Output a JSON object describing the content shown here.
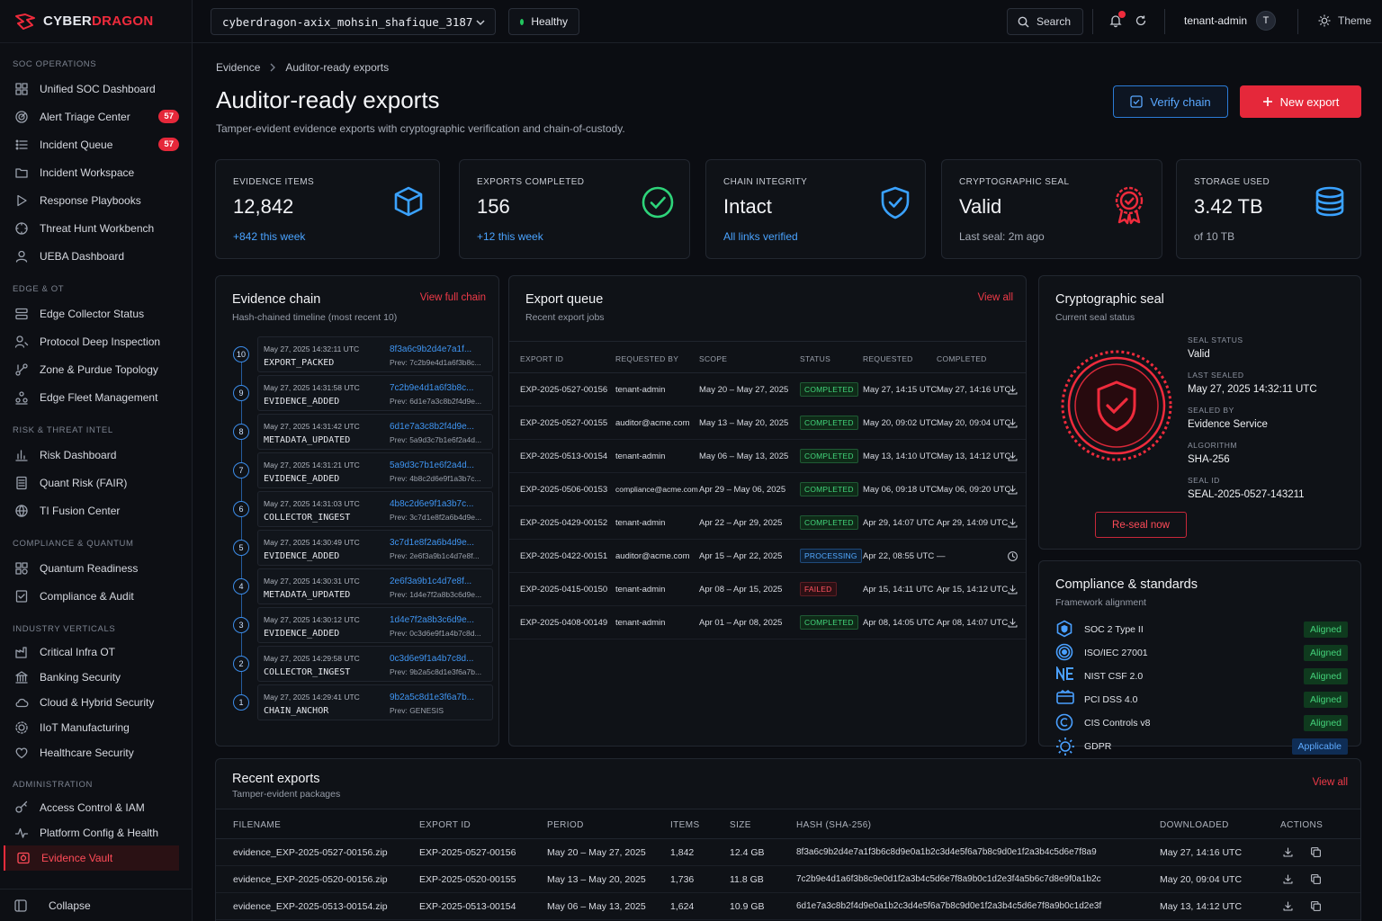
{
  "brand": {
    "name_a": "CYBER",
    "name_b": "DRAGON"
  },
  "topbar": {
    "tenant": "cyberdragon-axix_mohsin_shafique_3187",
    "health": "Healthy",
    "search": "Search",
    "user": "tenant-admin",
    "avatar": "T",
    "theme": "Theme"
  },
  "sidebar": {
    "sections": [
      {
        "title": "SOC OPERATIONS",
        "items": [
          {
            "label": "Unified SOC Dashboard",
            "icon": "grid-icon"
          },
          {
            "label": "Alert Triage Center",
            "icon": "radar-icon",
            "badge": "57"
          },
          {
            "label": "Incident Queue",
            "icon": "list-icon",
            "badge": "57"
          },
          {
            "label": "Incident Workspace",
            "icon": "folder-icon"
          },
          {
            "label": "Response Playbooks",
            "icon": "play-icon"
          },
          {
            "label": "Threat Hunt Workbench",
            "icon": "target-icon"
          },
          {
            "label": "UEBA Dashboard",
            "icon": "user-icon"
          }
        ]
      },
      {
        "title": "EDGE & OT",
        "items": [
          {
            "label": "Edge Collector Status",
            "icon": "server-icon"
          },
          {
            "label": "Protocol Deep Inspection",
            "icon": "inspect-icon"
          },
          {
            "label": "Zone & Purdue Topology",
            "icon": "topology-icon"
          },
          {
            "label": "Edge Fleet Management",
            "icon": "fleet-icon"
          }
        ]
      },
      {
        "title": "RISK & THREAT INTEL",
        "items": [
          {
            "label": "Risk Dashboard",
            "icon": "bar-chart-icon"
          },
          {
            "label": "Quant Risk (FAIR)",
            "icon": "calculator-icon"
          },
          {
            "label": "TI Fusion Center",
            "icon": "globe-icon"
          }
        ]
      },
      {
        "title": "COMPLIANCE & QUANTUM",
        "items": [
          {
            "label": "Quantum Readiness",
            "icon": "atom-icon"
          },
          {
            "label": "Compliance & Audit",
            "icon": "checklist-icon"
          }
        ]
      },
      {
        "title": "INDUSTRY VERTICALS",
        "items": [
          {
            "label": "Critical Infra OT",
            "icon": "factory-icon"
          },
          {
            "label": "Banking Security",
            "icon": "bank-icon"
          },
          {
            "label": "Cloud & Hybrid Security",
            "icon": "cloud-icon"
          },
          {
            "label": "IIoT Manufacturing",
            "icon": "chip-icon"
          },
          {
            "label": "Healthcare Security",
            "icon": "heart-icon"
          }
        ]
      },
      {
        "title": "ADMINISTRATION",
        "items": [
          {
            "label": "Access Control & IAM",
            "icon": "key-icon"
          },
          {
            "label": "Platform Config & Health",
            "icon": "pulse-icon"
          },
          {
            "label": "Evidence Vault",
            "icon": "vault-icon",
            "active": true
          }
        ]
      }
    ],
    "collapse": "Collapse"
  },
  "breadcrumb": {
    "parent": "Evidence",
    "current": "Auditor-ready exports"
  },
  "page": {
    "title": "Auditor-ready exports",
    "subtitle": "Tamper-evident evidence exports with cryptographic verification and chain-of-custody.",
    "verify_label": "Verify chain",
    "new_label": "New export"
  },
  "stats": [
    {
      "label": "EVIDENCE ITEMS",
      "value": "12,842",
      "note": "+842 this week",
      "note_color": "#4aa3ff",
      "icon": "cube-icon"
    },
    {
      "label": "EXPORTS COMPLETED",
      "value": "156",
      "note": "+12 this week",
      "note_color": "#4aa3ff",
      "icon": "check-circle-icon"
    },
    {
      "label": "CHAIN INTEGRITY",
      "value": "Intact",
      "note": "All links verified",
      "note_color": "#4aa3ff",
      "icon": "shield-check-icon"
    },
    {
      "label": "CRYPTOGRAPHIC SEAL",
      "value": "Valid",
      "note": "Last seal: 2m ago",
      "note_color": "#a7adb8",
      "icon": "award-icon"
    },
    {
      "label": "STORAGE USED",
      "value": "3.42 TB",
      "note": "of 10 TB",
      "note_color": "#a7adb8",
      "icon": "database-icon"
    }
  ],
  "chain": {
    "title": "Evidence chain",
    "subtitle": "Hash-chained timeline (most recent 10)",
    "link": "View full chain",
    "rows": [
      {
        "n": "10",
        "time": "May 27, 2025 14:32:11 UTC",
        "event": "EXPORT_PACKED",
        "hash": "8f3a6c9b2d4e7a1f...",
        "prev": "Prev: 7c2b9e4d1a6f3b8c..."
      },
      {
        "n": "9",
        "time": "May 27, 2025 14:31:58 UTC",
        "event": "EVIDENCE_ADDED",
        "hash": "7c2b9e4d1a6f3b8c...",
        "prev": "Prev: 6d1e7a3c8b2f4d9e..."
      },
      {
        "n": "8",
        "time": "May 27, 2025 14:31:42 UTC",
        "event": "METADATA_UPDATED",
        "hash": "6d1e7a3c8b2f4d9e...",
        "prev": "Prev: 5a9d3c7b1e6f2a4d..."
      },
      {
        "n": "7",
        "time": "May 27, 2025 14:31:21 UTC",
        "event": "EVIDENCE_ADDED",
        "hash": "5a9d3c7b1e6f2a4d...",
        "prev": "Prev: 4b8c2d6e9f1a3b7c..."
      },
      {
        "n": "6",
        "time": "May 27, 2025 14:31:03 UTC",
        "event": "COLLECTOR_INGEST",
        "hash": "4b8c2d6e9f1a3b7c...",
        "prev": "Prev: 3c7d1e8f2a6b4d9e..."
      },
      {
        "n": "5",
        "time": "May 27, 2025 14:30:49 UTC",
        "event": "EVIDENCE_ADDED",
        "hash": "3c7d1e8f2a6b4d9e...",
        "prev": "Prev: 2e6f3a9b1c4d7e8f..."
      },
      {
        "n": "4",
        "time": "May 27, 2025 14:30:31 UTC",
        "event": "METADATA_UPDATED",
        "hash": "2e6f3a9b1c4d7e8f...",
        "prev": "Prev: 1d4e7f2a8b3c6d9e..."
      },
      {
        "n": "3",
        "time": "May 27, 2025 14:30:12 UTC",
        "event": "EVIDENCE_ADDED",
        "hash": "1d4e7f2a8b3c6d9e...",
        "prev": "Prev: 0c3d6e9f1a4b7c8d..."
      },
      {
        "n": "2",
        "time": "May 27, 2025 14:29:58 UTC",
        "event": "COLLECTOR_INGEST",
        "hash": "0c3d6e9f1a4b7c8d...",
        "prev": "Prev: 9b2a5c8d1e3f6a7b..."
      },
      {
        "n": "1",
        "time": "May 27, 2025 14:29:41 UTC",
        "event": "CHAIN_ANCHOR",
        "hash": "9b2a5c8d1e3f6a7b...",
        "prev": "Prev: GENESIS"
      }
    ]
  },
  "queue": {
    "title": "Export queue",
    "subtitle": "Recent export jobs",
    "link": "View all",
    "columns": [
      "EXPORT ID",
      "REQUESTED BY",
      "SCOPE",
      "STATUS",
      "REQUESTED",
      "COMPLETED"
    ],
    "rows": [
      {
        "id": "EXP-2025-0527-00156",
        "by": "tenant-admin",
        "scope": "May 20 – May 27, 2025",
        "status": "COMPLETED",
        "requested": "May 27, 14:15 UTC",
        "completed": "May 27, 14:16 UTC",
        "action": "download-icon"
      },
      {
        "id": "EXP-2025-0527-00155",
        "by": "auditor@acme.com",
        "scope": "May 13 – May 20, 2025",
        "status": "COMPLETED",
        "requested": "May 20, 09:02 UTC",
        "completed": "May 20, 09:04 UTC",
        "action": "download-icon"
      },
      {
        "id": "EXP-2025-0513-00154",
        "by": "tenant-admin",
        "scope": "May 06 – May 13, 2025",
        "status": "COMPLETED",
        "requested": "May 13, 14:10 UTC",
        "completed": "May 13, 14:12 UTC",
        "action": "download-icon"
      },
      {
        "id": "EXP-2025-0506-00153",
        "by": "compliance@acme.com",
        "scope": "Apr 29 – May 06, 2025",
        "status": "COMPLETED",
        "requested": "May 06, 09:18 UTC",
        "completed": "May 06, 09:20 UTC",
        "action": "download-icon"
      },
      {
        "id": "EXP-2025-0429-00152",
        "by": "tenant-admin",
        "scope": "Apr 22 – Apr 29, 2025",
        "status": "COMPLETED",
        "requested": "Apr 29, 14:07 UTC",
        "completed": "Apr 29, 14:09 UTC",
        "action": "download-icon"
      },
      {
        "id": "EXP-2025-0422-00151",
        "by": "auditor@acme.com",
        "scope": "Apr 15 – Apr 22, 2025",
        "status": "PROCESSING",
        "requested": "Apr 22, 08:55 UTC",
        "completed": "—",
        "action": "clock-icon"
      },
      {
        "id": "EXP-2025-0415-00150",
        "by": "tenant-admin",
        "scope": "Apr 08 – Apr 15, 2025",
        "status": "FAILED",
        "requested": "Apr 15, 14:11 UTC",
        "completed": "Apr 15, 14:12 UTC",
        "action": "download-icon"
      },
      {
        "id": "EXP-2025-0408-00149",
        "by": "tenant-admin",
        "scope": "Apr 01 – Apr 08, 2025",
        "status": "COMPLETED",
        "requested": "Apr 08, 14:05 UTC",
        "completed": "Apr 08, 14:07 UTC",
        "action": "download-icon"
      }
    ]
  },
  "seal": {
    "title": "Cryptographic seal",
    "subtitle": "Current seal status",
    "fields": [
      {
        "label": "SEAL STATUS",
        "value": "Valid"
      },
      {
        "label": "LAST SEALED",
        "value": "May 27, 2025 14:32:11 UTC"
      },
      {
        "label": "SEALED BY",
        "value": "Evidence Service"
      },
      {
        "label": "ALGORITHM",
        "value": "SHA-256"
      },
      {
        "label": "SEAL ID",
        "value": "SEAL-2025-0527-143211"
      }
    ],
    "reseal": "Re-seal now"
  },
  "compliance": {
    "title": "Compliance & standards",
    "subtitle": "Framework alignment",
    "items": [
      {
        "name": "SOC 2 Type II",
        "status": "Aligned",
        "icon": "soc2-icon"
      },
      {
        "name": "ISO/IEC 27001",
        "status": "Aligned",
        "icon": "iso-icon"
      },
      {
        "name": "NIST CSF 2.0",
        "status": "Aligned",
        "icon": "nist-icon"
      },
      {
        "name": "PCI DSS 4.0",
        "status": "Aligned",
        "icon": "pci-icon"
      },
      {
        "name": "CIS Controls v8",
        "status": "Aligned",
        "icon": "cis-icon"
      },
      {
        "name": "GDPR",
        "status": "Applicable",
        "icon": "gdpr-icon"
      }
    ]
  },
  "recent": {
    "title": "Recent exports",
    "subtitle": "Tamper-evident packages",
    "link": "View all",
    "columns": [
      "FILENAME",
      "EXPORT ID",
      "PERIOD",
      "ITEMS",
      "SIZE",
      "HASH (SHA-256)",
      "DOWNLOADED",
      "ACTIONS"
    ],
    "rows": [
      {
        "file": "evidence_EXP-2025-0527-00156.zip",
        "id": "EXP-2025-0527-00156",
        "period": "May 20 – May 27, 2025",
        "items": "1,842",
        "size": "12.4 GB",
        "hash": "8f3a6c9b2d4e7a1f3b6c8d9e0a1b2c3d4e5f6a7b8c9d0e1f2a3b4c5d6e7f8a9",
        "downloaded": "May 27, 14:16 UTC"
      },
      {
        "file": "evidence_EXP-2025-0520-00156.zip",
        "id": "EXP-2025-0520-00155",
        "period": "May 13 – May 20, 2025",
        "items": "1,736",
        "size": "11.8 GB",
        "hash": "7c2b9e4d1a6f3b8c9e0d1f2a3b4c5d6e7f8a9b0c1d2e3f4a5b6c7d8e9f0a1b2c",
        "downloaded": "May 20, 09:04 UTC"
      },
      {
        "file": "evidence_EXP-2025-0513-00154.zip",
        "id": "EXP-2025-0513-00154",
        "period": "May 06 – May 13, 2025",
        "items": "1,624",
        "size": "10.9 GB",
        "hash": "6d1e7a3c8b2f4d9e0a1b2c3d4e5f6a7b8c9d0e1f2a3b4c5d6e7f8a9b0c1d2e3f",
        "downloaded": "May 13, 14:12 UTC"
      }
    ]
  }
}
